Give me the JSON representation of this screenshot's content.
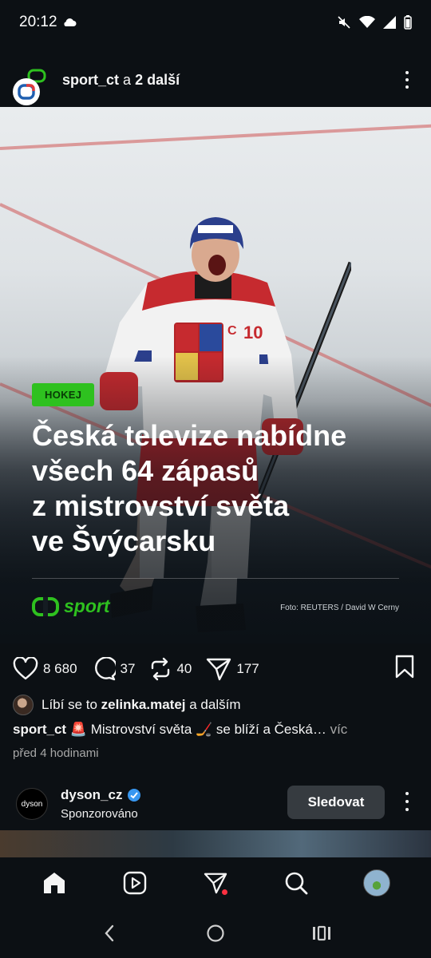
{
  "status": {
    "time": "20:12"
  },
  "post": {
    "account": "sport_ct",
    "collab_connector": "a",
    "collab_others": "2 další",
    "tag": "HOKEJ",
    "headline_lines": [
      "Česká televize nabídne",
      "všech 64 zápasů",
      "z mistrovství světa",
      "ve Švýcarsku"
    ],
    "brand": "sport",
    "photo_credit": "Foto: REUTERS / David W Cerny",
    "likes": "8 680",
    "comments": "37",
    "reposts": "40",
    "shares": "177",
    "liked_by_prefix": "Líbí se to",
    "liked_by_user": "zelinka.matej",
    "liked_by_suffix": "a dalším",
    "caption_user": "sport_ct",
    "caption_text": "🚨 Mistrovství světa 🏒 se blíží a Česká…",
    "caption_more": "víc",
    "time_ago": "před 4 hodinami"
  },
  "sponsored": {
    "name": "dyson_cz",
    "avatar_text": "dyson",
    "sub": "Sponzorováno",
    "follow_label": "Sledovat"
  },
  "colors": {
    "accent_green": "#2ec11f",
    "background": "#0c1014",
    "notif": "#ff3040"
  }
}
